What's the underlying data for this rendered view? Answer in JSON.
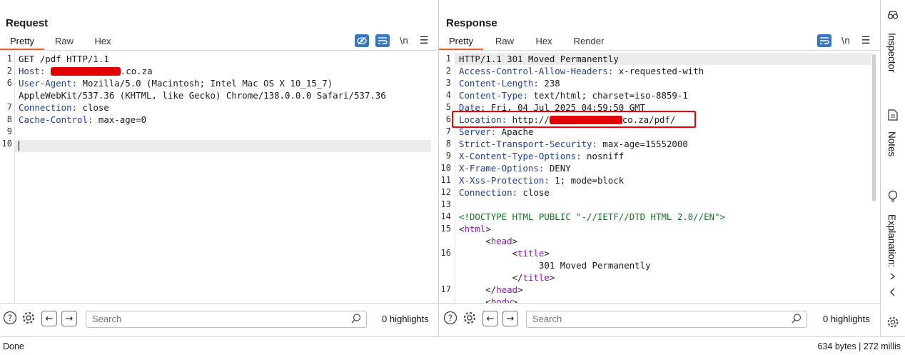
{
  "request": {
    "title": "Request",
    "tabs": [
      "Pretty",
      "Raw",
      "Hex"
    ],
    "toolbar": {
      "newline_label": "\\n",
      "menu_glyph": "☰"
    },
    "lines": [
      {
        "num": "1",
        "parts": [
          {
            "t": "GET /pdf HTTP/1.1"
          }
        ]
      },
      {
        "num": "2",
        "parts": [
          {
            "t": "Host:",
            "c": "k"
          },
          {
            "t": " "
          },
          {
            "red": true
          },
          {
            "t": ".co.za"
          }
        ]
      },
      {
        "num": "6",
        "parts": [
          {
            "t": "User-Agent:",
            "c": "k"
          },
          {
            "t": " Mozilla/5.0 (Macintosh; Intel Mac OS X 10_15_7)"
          }
        ]
      },
      {
        "num": "",
        "parts": [
          {
            "t": "AppleWebKit/537.36 (KHTML, like Gecko) Chrome/138.0.0.0 Safari/537.36"
          }
        ]
      },
      {
        "num": "7",
        "parts": [
          {
            "t": "Connection:",
            "c": "k"
          },
          {
            "t": " close"
          }
        ]
      },
      {
        "num": "8",
        "parts": [
          {
            "t": "Cache-Control:",
            "c": "k"
          },
          {
            "t": " max-age=0"
          }
        ]
      },
      {
        "num": "9",
        "parts": []
      },
      {
        "num": "10",
        "parts": []
      }
    ],
    "search_placeholder": "Search",
    "highlights": "0 highlights"
  },
  "response": {
    "title": "Response",
    "tabs": [
      "Pretty",
      "Raw",
      "Hex",
      "Render"
    ],
    "toolbar": {
      "newline_label": "\\n",
      "menu_glyph": "☰"
    },
    "lines": [
      {
        "num": "1",
        "parts": [
          {
            "t": "HTTP/1.1 301 Moved Permanently"
          }
        ]
      },
      {
        "num": "2",
        "parts": [
          {
            "t": "Access-Control-Allow-Headers:",
            "c": "k"
          },
          {
            "t": " x-requested-with"
          }
        ]
      },
      {
        "num": "3",
        "parts": [
          {
            "t": "Content-Length:",
            "c": "k"
          },
          {
            "t": " 238"
          }
        ]
      },
      {
        "num": "4",
        "parts": [
          {
            "t": "Content-Type:",
            "c": "k"
          },
          {
            "t": " text/html; charset=iso-8859-1"
          }
        ]
      },
      {
        "num": "5",
        "parts": [
          {
            "t": "Date:",
            "c": "k"
          },
          {
            "t": " Fri, 04 Jul 2025 04:59:50 GMT"
          }
        ]
      },
      {
        "num": "6",
        "parts": [
          {
            "t": "Location:",
            "c": "k"
          },
          {
            "t": " http://"
          },
          {
            "red": true,
            "r2": true
          },
          {
            "t": "co.za/pdf/"
          }
        ]
      },
      {
        "num": "7",
        "parts": [
          {
            "t": "Server:",
            "c": "k"
          },
          {
            "t": " Apache"
          }
        ]
      },
      {
        "num": "8",
        "parts": [
          {
            "t": "Strict-Transport-Security:",
            "c": "k"
          },
          {
            "t": " max-age=15552000"
          }
        ]
      },
      {
        "num": "9",
        "parts": [
          {
            "t": "X-Content-Type-Options:",
            "c": "k"
          },
          {
            "t": " nosniff"
          }
        ]
      },
      {
        "num": "10",
        "parts": [
          {
            "t": "X-Frame-Options:",
            "c": "k"
          },
          {
            "t": " DENY"
          }
        ]
      },
      {
        "num": "11",
        "parts": [
          {
            "t": "X-Xss-Protection:",
            "c": "k"
          },
          {
            "t": " 1; mode=block"
          }
        ]
      },
      {
        "num": "12",
        "parts": [
          {
            "t": "Connection:",
            "c": "k"
          },
          {
            "t": " close"
          }
        ]
      },
      {
        "num": "13",
        "parts": []
      },
      {
        "num": "14",
        "parts": [
          {
            "t": "<!DOCTYPE HTML PUBLIC \"-//IETF//DTD HTML 2.0//EN\">",
            "c": "dt"
          }
        ]
      },
      {
        "num": "15",
        "parts": [
          {
            "t": "<"
          },
          {
            "t": "html",
            "c": "tagc"
          },
          {
            "t": ">"
          }
        ]
      },
      {
        "num": "",
        "parts": [
          {
            "t": "     <"
          },
          {
            "t": "head",
            "c": "tagc"
          },
          {
            "t": ">"
          }
        ]
      },
      {
        "num": "16",
        "parts": [
          {
            "t": "          <"
          },
          {
            "t": "title",
            "c": "tagc"
          },
          {
            "t": ">"
          }
        ]
      },
      {
        "num": "",
        "parts": [
          {
            "t": "               301 Moved Permanently"
          }
        ]
      },
      {
        "num": "",
        "parts": [
          {
            "t": "          </"
          },
          {
            "t": "title",
            "c": "tagc"
          },
          {
            "t": ">"
          }
        ]
      },
      {
        "num": "17",
        "parts": [
          {
            "t": "     </"
          },
          {
            "t": "head",
            "c": "tagc"
          },
          {
            "t": ">"
          }
        ]
      },
      {
        "num": "",
        "parts": [
          {
            "t": "     <"
          },
          {
            "t": "body",
            "c": "tagc"
          },
          {
            "t": ">"
          }
        ]
      }
    ],
    "search_placeholder": "Search",
    "highlights": "0 highlights"
  },
  "sidebar": {
    "items": [
      "Inspector",
      "Notes",
      "Explanation:"
    ]
  },
  "status": {
    "left": "Done",
    "right": "634 bytes | 272 millis"
  },
  "colors": {
    "accent_tab": "#e8622c",
    "toolbar_blue": "#3876bd",
    "header_key": "#1f3f99",
    "tag": "#8b1aa8",
    "doctype": "#0a7a1e",
    "redaction": "#e00000",
    "highlight_box": "#e8000a"
  }
}
